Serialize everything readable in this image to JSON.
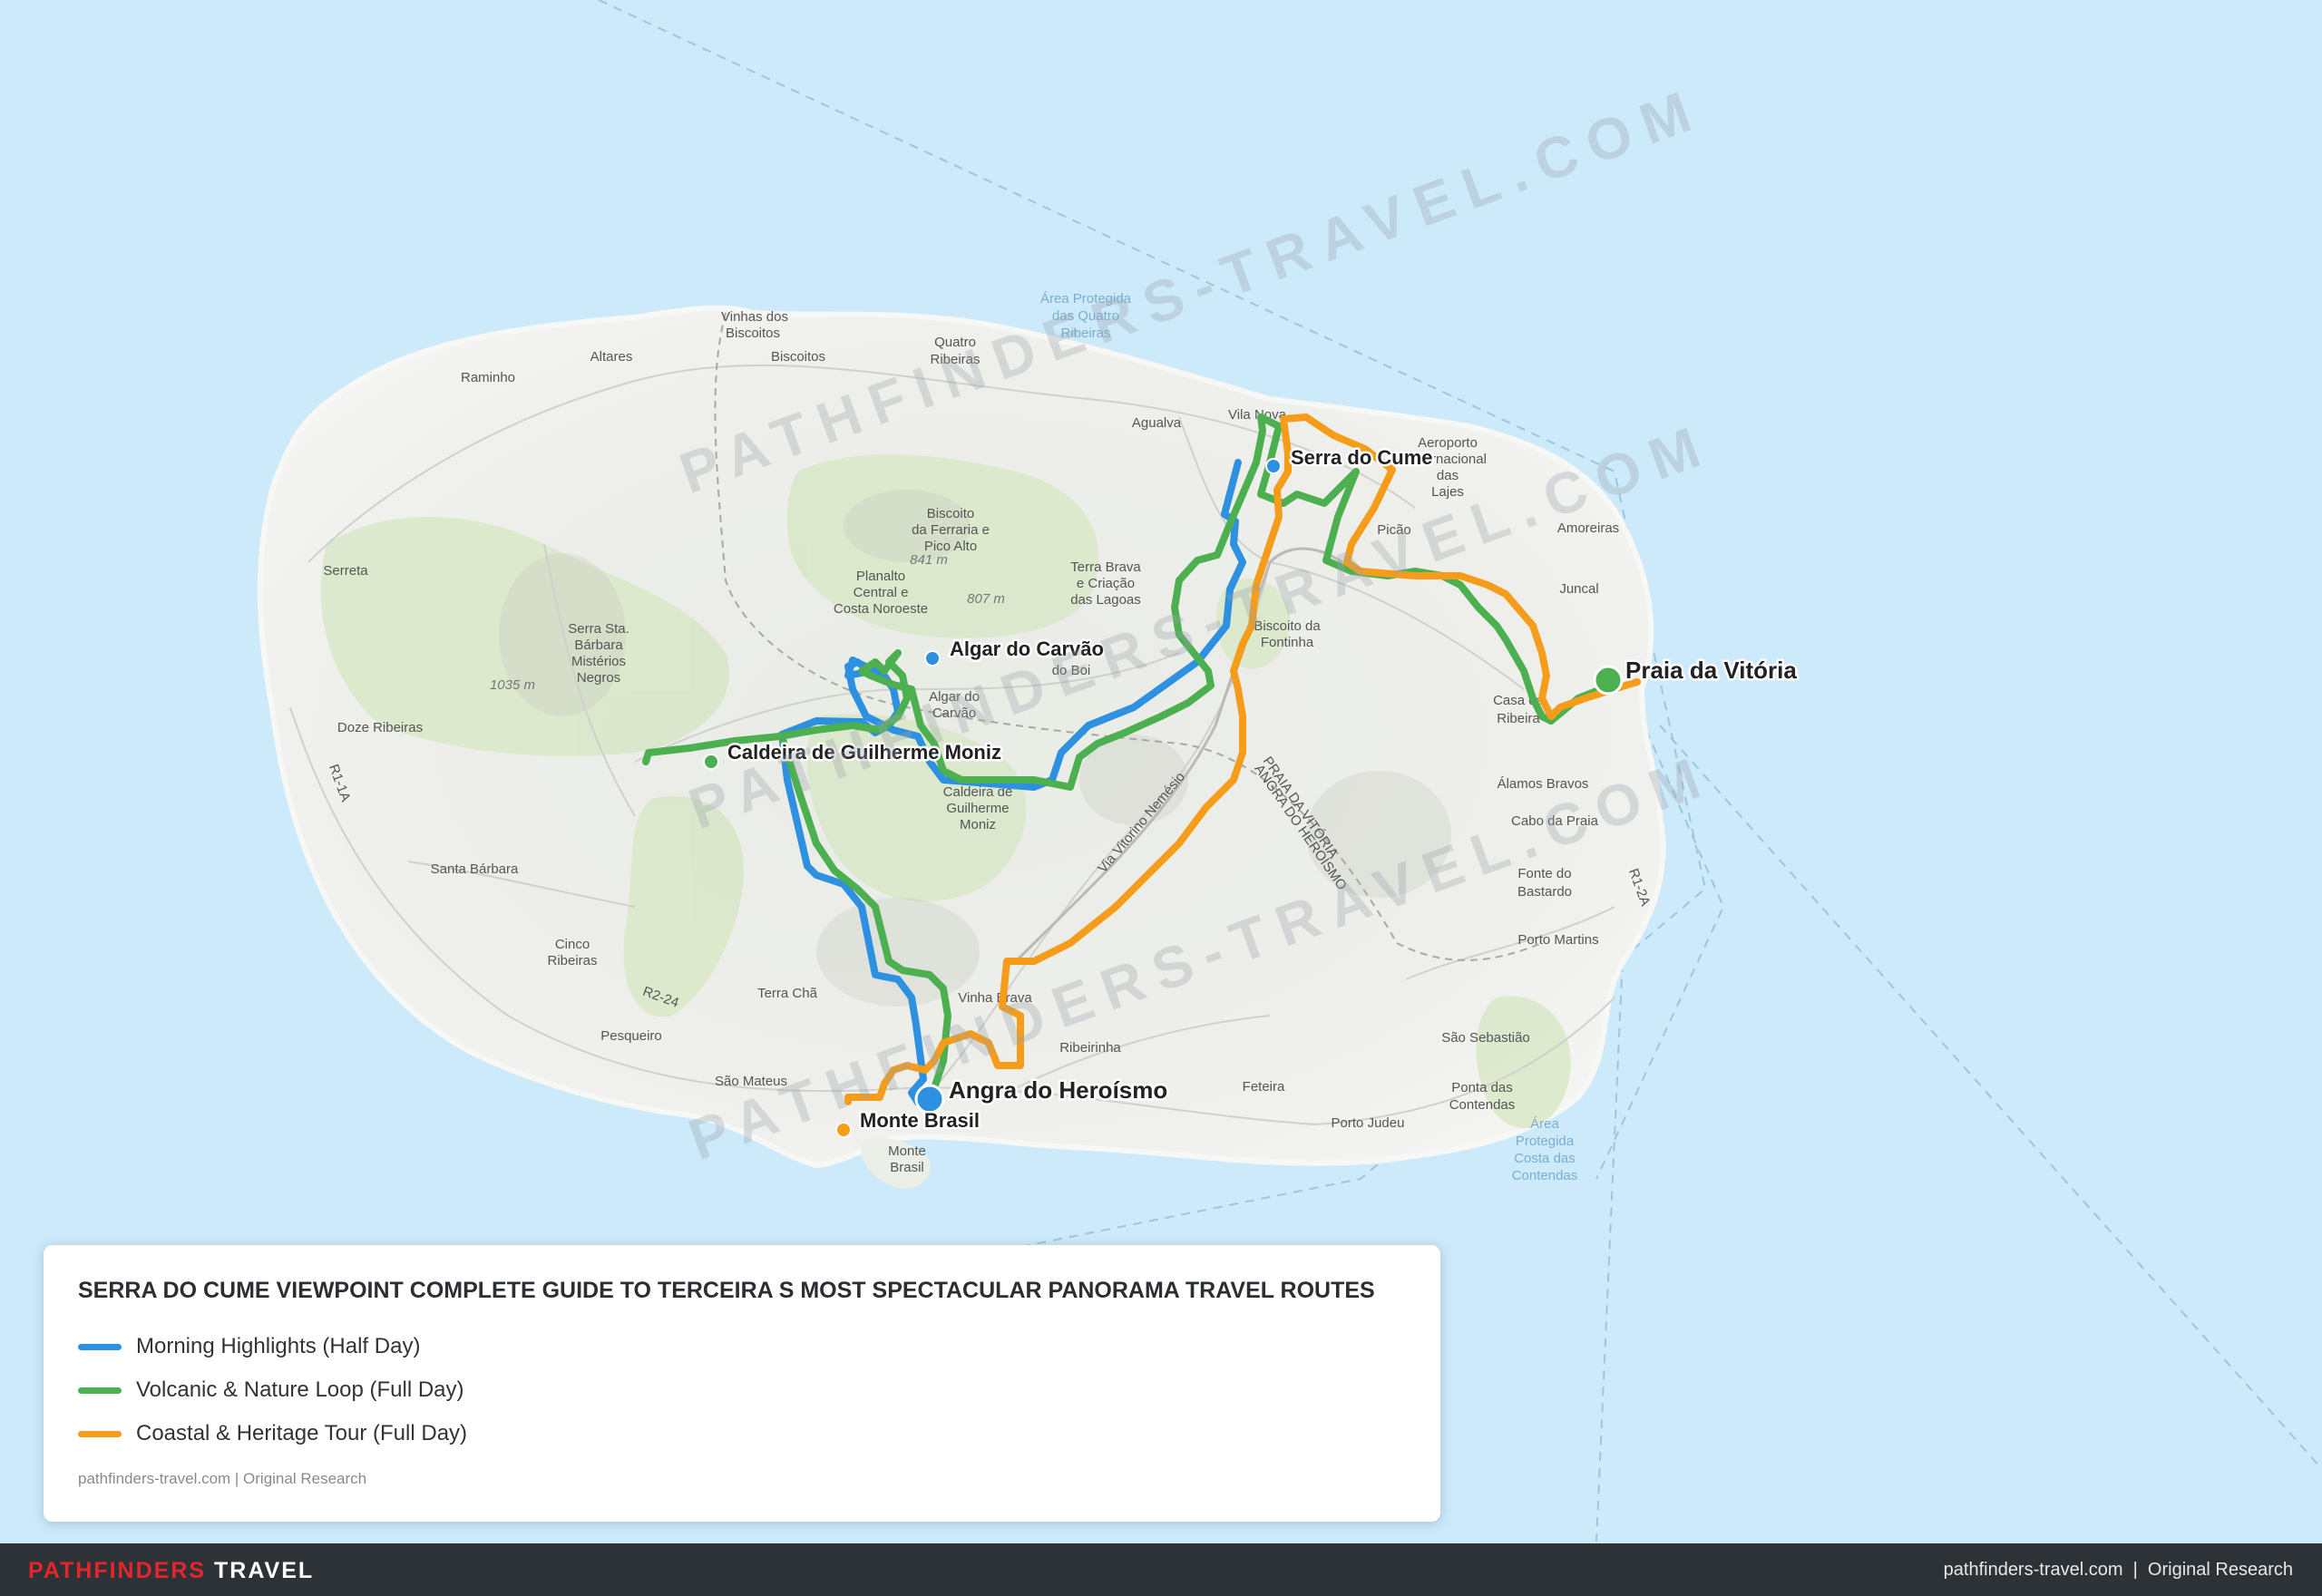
{
  "title": "SERRA DO CUME VIEWPOINT COMPLETE GUIDE TO TERCEIRA S MOST SPECTACULAR PANORAMA TRAVEL ROUTES",
  "legend": {
    "items": [
      {
        "label": "Morning Highlights (Half Day)",
        "color": "#2e90e0"
      },
      {
        "label": "Volcanic & Nature Loop (Full Day)",
        "color": "#4caf50"
      },
      {
        "label": "Coastal & Heritage Tour (Full Day)",
        "color": "#f59c1a"
      }
    ],
    "source": "pathfinders-travel.com | Original Research"
  },
  "footer": {
    "brand_red": "PATHFINDERS",
    "brand_white": "TRAVEL",
    "right": "pathfinders-travel.com  |  Original Research"
  },
  "watermark": "PATHFINDERS-TRAVEL.COM",
  "pois": {
    "serra_do_cume": "Serra do Cume",
    "algar_do_carvao": "Algar do Carvão",
    "praia_da_vitoria": "Praia da Vitória",
    "caldeira": "Caldeira de Guilherme Moniz",
    "angra": "Angra do Heroísmo",
    "monte_brasil": "Monte Brasil"
  },
  "map_labels": {
    "vinhas": "Vinhas dos",
    "biscoitos_a": "Biscoitos",
    "biscoitos": "Biscoitos",
    "altares": "Altares",
    "raminho": "Raminho",
    "quatro_a": "Quatro",
    "quatro_b": "Ribeiras",
    "area1": "Área Protegida",
    "area2": "das Quatro",
    "area3": "Ribeiras",
    "agualva": "Agualva",
    "vila_nova": "Vila Nova",
    "aero1": "Aeroporto",
    "aero2": "Internacional",
    "aero3": "das",
    "aero4": "Lajes",
    "picao": "Picão",
    "amoreiras": "Amoreiras",
    "juncal": "Juncal",
    "serreta": "Serreta",
    "biscoito_f1": "Biscoito",
    "biscoito_f2": "da Ferraria e",
    "biscoito_f3": "Pico Alto",
    "elev841": "841 m",
    "planalto1": "Planalto",
    "planalto2": "Central e",
    "planalto3": "Costa Noroeste",
    "elev807": "807 m",
    "terra_brava1": "Terra Brava",
    "terra_brava2": "e Criação",
    "terra_brava3": "das Lagoas",
    "serra_sta1": "Serra Sta.",
    "serra_sta2": "Bárbara",
    "serra_sta3": "Mistérios",
    "serra_sta4": "Negros",
    "elev1035": "1035 m",
    "biscoito_s1": "Biscoito da",
    "biscoito_s2": "Fontinha",
    "algar_l1": "Algar do",
    "algar_l2": "Carvão",
    "do_boi": "do Boi",
    "doze": "Doze Ribeiras",
    "casa1": "Casa da",
    "casa2": "Ribeira",
    "alamos": "Álamos Bravos",
    "cabo": "Cabo da Praia",
    "caldeira_l1": "Caldeira de",
    "caldeira_l2": "Guilherme",
    "caldeira_l3": "Moniz",
    "via_vitorino": "Via Vitorino Nemésio",
    "via_praia": "PRAIA DA VITÓRIA",
    "via_angra": "ANGRA DO HEROÍSMO",
    "santa_barbara": "Santa Bárbara",
    "fonte1": "Fonte do",
    "fonte2": "Bastardo",
    "r11a": "R1-1A",
    "r12a": "R1-2A",
    "r24": "R2-24",
    "cinco1": "Cinco",
    "cinco2": "Ribeiras",
    "porto_martins": "Porto Martins",
    "terra_cha": "Terra Chã",
    "vinha_brava": "Vinha Brava",
    "pesqueiro": "Pesqueiro",
    "ribeirinha": "Ribeirinha",
    "sao_sebastiao": "São Sebastião",
    "sao_mateus": "São Mateus",
    "feteira": "Feteira",
    "ponta1": "Ponta das",
    "ponta2": "Contendas",
    "porto_judeu": "Porto Judeu",
    "area_c1": "Área",
    "area_c2": "Protegida",
    "area_c3": "Costa das",
    "area_c4": "Contendas",
    "monte1": "Monte",
    "monte2": "Brasil"
  }
}
